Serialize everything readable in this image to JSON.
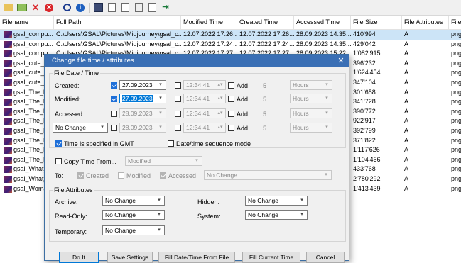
{
  "columns": [
    "Filename",
    "Full Path",
    "Modified Time",
    "Created Time",
    "Accessed Time",
    "File Size",
    "File Attributes",
    "File"
  ],
  "rows": [
    {
      "name": "gsal_compu...",
      "path": "C:\\Users\\GSAL\\Pictures\\Midjourney\\gsal_c...",
      "modified": "12.07.2022 17:26:...",
      "created": "12.07.2022 17:26:...",
      "accessed": "28.09.2023 14:35:...",
      "size": "410'994",
      "attr": "A",
      "ext": "png"
    },
    {
      "name": "gsal_compu...",
      "path": "C:\\Users\\GSAL\\Pictures\\Midjourney\\gsal_c...",
      "modified": "12.07.2022 17:24:...",
      "created": "12.07.2022 17:24:...",
      "accessed": "28.09.2023 14:35:...",
      "size": "429'042",
      "attr": "A",
      "ext": "png"
    },
    {
      "name": "gsal_compu...",
      "path": "C:\\Users\\GSAL\\Pictures\\Midjourney\\gsal_c...",
      "modified": "12.07.2022 17:27:...",
      "created": "12.07.2022 17:27:...",
      "accessed": "28.09.2023 15:22:...",
      "size": "1'082'915",
      "attr": "A",
      "ext": "png"
    },
    {
      "name": "gsal_cute_b...",
      "path": "",
      "modified": "",
      "created": "",
      "accessed": "",
      "size": "396'232",
      "attr": "A",
      "ext": "png"
    },
    {
      "name": "gsal_cute_b...",
      "path": "",
      "modified": "",
      "created": "",
      "accessed": "",
      "size": "1'624'454",
      "attr": "A",
      "ext": "png"
    },
    {
      "name": "gsal_cute_b...",
      "path": "",
      "modified": "",
      "created": "",
      "accessed": "",
      "size": "347'104",
      "attr": "A",
      "ext": "png"
    },
    {
      "name": "gsal_The_bl...",
      "path": "",
      "modified": "",
      "created": "",
      "accessed": "",
      "size": "301'658",
      "attr": "A",
      "ext": "png"
    },
    {
      "name": "gsal_The_bl...",
      "path": "",
      "modified": "",
      "created": "",
      "accessed": "",
      "size": "341'728",
      "attr": "A",
      "ext": "png"
    },
    {
      "name": "gsal_The_bl...",
      "path": "",
      "modified": "",
      "created": "",
      "accessed": "",
      "size": "390'772",
      "attr": "A",
      "ext": "png"
    },
    {
      "name": "gsal_The_Fl...",
      "path": "",
      "modified": "",
      "created": "",
      "accessed": "",
      "size": "922'917",
      "attr": "A",
      "ext": "png"
    },
    {
      "name": "gsal_The_Fl...",
      "path": "",
      "modified": "",
      "created": "",
      "accessed": "",
      "size": "392'799",
      "attr": "A",
      "ext": "png"
    },
    {
      "name": "gsal_The_Fl...",
      "path": "",
      "modified": "",
      "created": "",
      "accessed": "",
      "size": "371'822",
      "attr": "A",
      "ext": "png"
    },
    {
      "name": "gsal_The_Fl...",
      "path": "",
      "modified": "",
      "created": "",
      "accessed": "",
      "size": "1'117'626",
      "attr": "A",
      "ext": "png"
    },
    {
      "name": "gsal_The_Fl...",
      "path": "",
      "modified": "",
      "created": "",
      "accessed": "",
      "size": "1'104'466",
      "attr": "A",
      "ext": "png"
    },
    {
      "name": "gsal_What_...",
      "path": "",
      "modified": "",
      "created": "",
      "accessed": "",
      "size": "433'768",
      "attr": "A",
      "ext": "png"
    },
    {
      "name": "gsal_What_...",
      "path": "",
      "modified": "",
      "created": "",
      "accessed": "",
      "size": "2'780'292",
      "attr": "A",
      "ext": "png"
    },
    {
      "name": "gsal_Woma...",
      "path": "",
      "modified": "",
      "created": "",
      "accessed": "",
      "size": "1'413'439",
      "attr": "A",
      "ext": "png"
    }
  ],
  "dialog": {
    "title": "Change file time / attributes",
    "close": "✕",
    "group_datetime": "File Date / Time",
    "created_label": "Created:",
    "modified_label": "Modified:",
    "accessed_label": "Accessed:",
    "nochange": "No Change",
    "created_date": "27.09.2023",
    "modified_date": "27.09.2023",
    "accessed_date": "28.09.2023",
    "row4_date": "28.09.2023",
    "time": "12:34:41",
    "add": "Add",
    "five": "5",
    "hours": "Hours",
    "gmt": "Time is specified in GMT",
    "sequence": "Date/time sequence mode",
    "copy_from": "Copy Time From...",
    "copy_from_value": "Modified",
    "to": "To:",
    "to_created": "Created",
    "to_modified": "Modified",
    "to_accessed": "Accessed",
    "to_nochange": "No Change",
    "group_attributes": "File Attributes",
    "archive": "Archive:",
    "readonly": "Read-Only:",
    "temporary": "Temporary:",
    "hidden": "Hidden:",
    "system": "System:",
    "btn_do": "Do It",
    "btn_save": "Save Settings",
    "btn_fill_file": "Fill Date/Time From File",
    "btn_fill_current": "Fill Current Time",
    "btn_cancel": "Cancel"
  }
}
